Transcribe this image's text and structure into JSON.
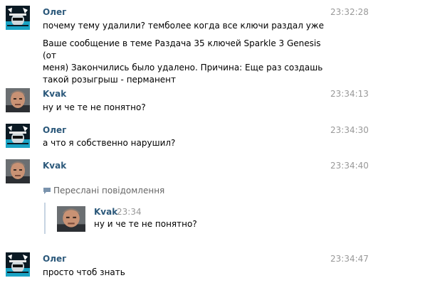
{
  "messages": [
    {
      "author": "Олег",
      "time": "23:32:28",
      "avatar": "oleg-avatar",
      "lines": [
        "почему тему удалили? темболее когда все ключи раздал уже",
        "",
        "Ваше сообщение в теме Раздача 35 ключей Sparkle 3 Genesis (от",
        "меня) Закончились было удалено. Причина: Еще раз создашь",
        "такой розыгрыш - перманент"
      ]
    },
    {
      "author": "Kvak",
      "time": "23:34:13",
      "avatar": "kvak-avatar",
      "lines": [
        "ну и че те не понятно?"
      ]
    },
    {
      "author": "Олег",
      "time": "23:34:30",
      "avatar": "oleg-avatar",
      "lines": [
        "а что я собственно нарушил?"
      ]
    },
    {
      "author": "Kvak",
      "time": "23:34:40",
      "avatar": "kvak-avatar"
    },
    {
      "author": "Олег",
      "time": "23:34:47",
      "avatar": "oleg-avatar",
      "lines": [
        "просто чтоб знать"
      ]
    }
  ],
  "forwarded": {
    "header": "Переслані повідомлення",
    "icon": "speech-bubble-icon",
    "author": "Kvak",
    "time": "23:34",
    "text": "ну и че те не понятно?"
  },
  "colors": {
    "author": "#2b587a",
    "time": "#999999",
    "forward_bar": "#c7d4e2"
  }
}
